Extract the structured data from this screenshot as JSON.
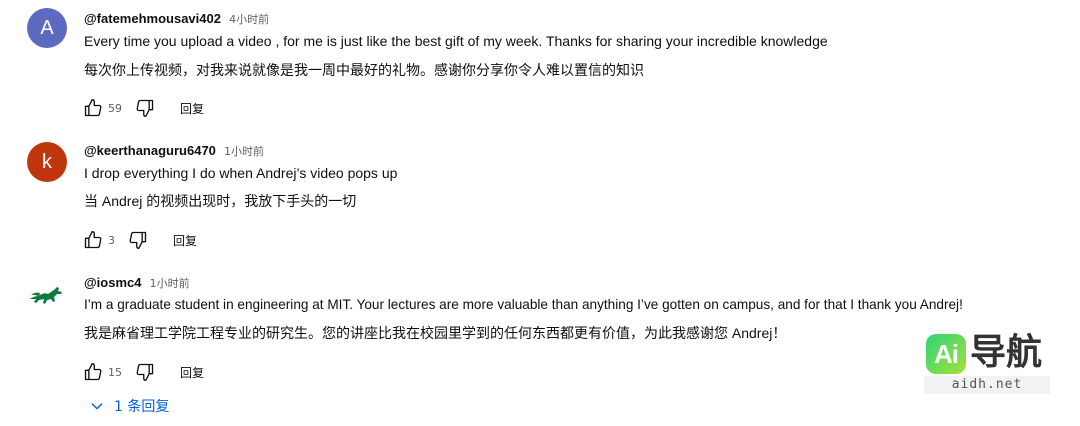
{
  "comments": [
    {
      "avatar_letter": "A",
      "avatar_color": "#5c6bc0",
      "handle": "@fatemehmousavi402",
      "time": "4小时前",
      "text_en": "Every time you upload a video , for me is just like the best gift of my week. Thanks for sharing your incredible knowledge",
      "text_zh": "每次你上传视频，对我来说就像是我一周中最好的礼物。感谢你分享你令人难以置信的知识",
      "likes": "59",
      "reply_label": "回复"
    },
    {
      "avatar_letter": "k",
      "avatar_color": "#bf360c",
      "handle": "@keerthanaguru6470",
      "time": "1小时前",
      "text_en": "I drop everything I do when Andrej’s video pops up",
      "text_zh": "当 Andrej 的视频出现时，我放下手头的一切",
      "likes": "3",
      "reply_label": "回复"
    },
    {
      "avatar_icon": "mustang-horse-icon",
      "avatar_color": "#0a7a3e",
      "handle": "@iosmc4",
      "time": "1小时前",
      "text_en": "I’m a graduate student in engineering at MIT. Your lectures are more valuable than anything I’ve gotten on campus, and for that I thank you Andrej!",
      "text_zh": "我是麻省理工学院工程专业的研究生。您的讲座比我在校园里学到的任何东西都更有价值，为此我感谢您 Andrej！",
      "likes": "15",
      "reply_label": "回复"
    }
  ],
  "replies_toggle": {
    "label": "1 条回复",
    "color": "#065fd4"
  },
  "watermark": {
    "badge": "Ai",
    "title": "导航",
    "url": "aidh.net"
  }
}
